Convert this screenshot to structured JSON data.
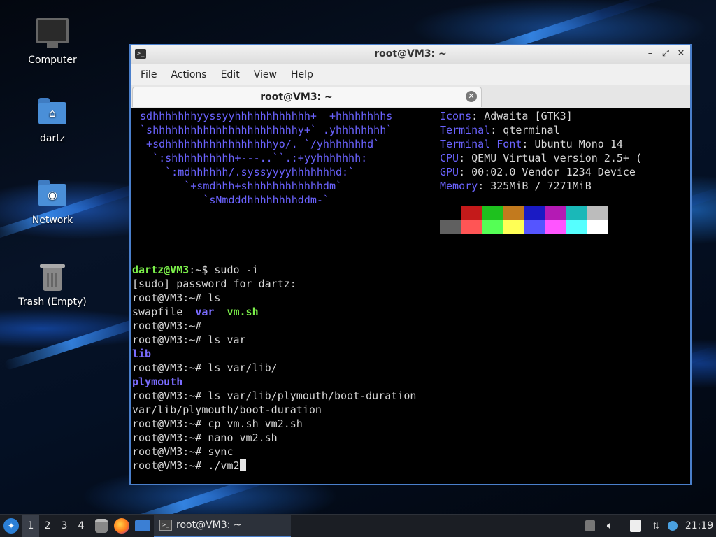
{
  "desktop": {
    "icons": [
      {
        "label": "Computer"
      },
      {
        "label": "dartz"
      },
      {
        "label": "Network"
      },
      {
        "label": "Trash (Empty)"
      }
    ]
  },
  "window": {
    "title": "root@VM3: ~",
    "menu": [
      "File",
      "Actions",
      "Edit",
      "View",
      "Help"
    ],
    "tab_label": "root@VM3: ~"
  },
  "terminal": {
    "art": [
      " sdhhhhhhhyyssyyhhhhhhhhhhhh+  +hhhhhhhhs",
      " `shhhhhhhhhhhhhhhhhhhhhhhy+` .yhhhhhhhh`",
      "  +sdhhhhhhhhhhhhhhhhhyo/. `/yhhhhhhhd`",
      "   `:shhhhhhhhhh+---..``.:+yyhhhhhhh:",
      "     `:mdhhhhhh/.syssyyyyhhhhhhhd:`",
      "        `+smdhhh+shhhhhhhhhhhhdm`",
      "           `sNmdddhhhhhhhhddm-`"
    ],
    "info": [
      {
        "label": "Icons",
        "value": ": Adwaita [GTK3]"
      },
      {
        "label": "Terminal",
        "value": ": qterminal"
      },
      {
        "label": "Terminal Font",
        "value": ": Ubuntu Mono 14"
      },
      {
        "label": "CPU",
        "value": ": QEMU Virtual version 2.5+ ("
      },
      {
        "label": "GPU",
        "value": ": 00:02.0 Vendor 1234 Device"
      },
      {
        "label": "Memory",
        "value": ": 325MiB / 7271MiB"
      }
    ],
    "palette_top": [
      "#000000",
      "#c41a1a",
      "#1ec11e",
      "#c27a1e",
      "#1a1ac4",
      "#b41ab4",
      "#1ab8b8",
      "#bcbcbc"
    ],
    "palette_bottom": [
      "#606060",
      "#ff5555",
      "#55ff55",
      "#ffff55",
      "#5555ff",
      "#ff55ff",
      "#55ffff",
      "#ffffff"
    ],
    "prompt_user": "dartz@VM3",
    "prompt_path": ":~$ ",
    "first_cmd": "sudo -i",
    "lines": [
      {
        "text": "[sudo] password for dartz:"
      },
      {
        "text": "root@VM3:~# ls"
      },
      {
        "parts": [
          {
            "text": "swapfile  ",
            "cls": ""
          },
          {
            "text": "var",
            "cls": "bold-blue"
          },
          {
            "text": "  ",
            "cls": ""
          },
          {
            "text": "vm.sh",
            "cls": "green"
          }
        ]
      },
      {
        "text": "root@VM3:~#"
      },
      {
        "text": "root@VM3:~# ls var"
      },
      {
        "text": "lib",
        "cls": "bold-blue"
      },
      {
        "text": "root@VM3:~# ls var/lib/"
      },
      {
        "text": "plymouth",
        "cls": "bold-blue"
      },
      {
        "text": "root@VM3:~# ls var/lib/plymouth/boot-duration"
      },
      {
        "text": "var/lib/plymouth/boot-duration"
      },
      {
        "text": "root@VM3:~# cp vm.sh vm2.sh"
      },
      {
        "text": "root@VM3:~# nano vm2.sh"
      },
      {
        "text": "root@VM3:~# sync"
      },
      {
        "text": "root@VM3:~# ./vm2",
        "cursor": true
      }
    ]
  },
  "taskbar": {
    "workspaces": [
      "1",
      "2",
      "3",
      "4"
    ],
    "task_label": "root@VM3: ~",
    "clock": "21:19"
  },
  "colors": {
    "accent": "#4a7fcb",
    "art": "#6b63ff",
    "exec_green": "#7cf04a"
  }
}
